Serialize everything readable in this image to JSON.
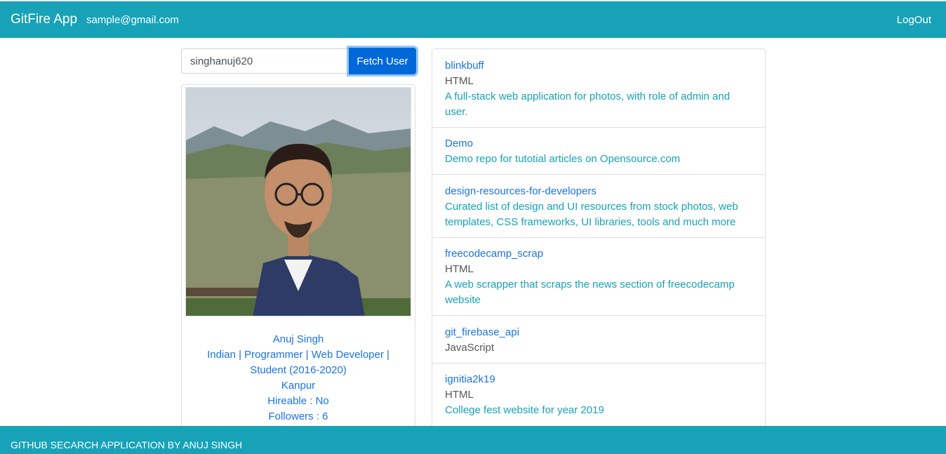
{
  "navbar": {
    "brand": "GitFire App",
    "email": "sample@gmail.com",
    "logout": "LogOut"
  },
  "search": {
    "value": "singhanuj620",
    "button_label": "Fetch User"
  },
  "profile": {
    "name": "Anuj Singh",
    "bio": "Indian | Programmer | Web Developer | Student (2016-2020)",
    "location": "Kanpur",
    "hireable": "Hireable : No",
    "followers": "Followers : 6"
  },
  "repos": [
    {
      "name": "blinkbuff",
      "language": "HTML",
      "description": "A full-stack web application for photos, with role of admin and user."
    },
    {
      "name": "Demo",
      "language": "",
      "description": "Demo repo for tutotial articles on Opensource.com"
    },
    {
      "name": "design-resources-for-developers",
      "language": "",
      "description": "Curated list of design and UI resources from stock photos, web templates, CSS frameworks, UI libraries, tools and much more"
    },
    {
      "name": "freecodecamp_scrap",
      "language": "HTML",
      "description": "A web scrapper that scraps the news section of freecodecamp website"
    },
    {
      "name": "git_firebase_api",
      "language": "JavaScript",
      "description": ""
    },
    {
      "name": "ignitia2k19",
      "language": "HTML",
      "description": "College fest website for year 2019"
    }
  ],
  "footer": {
    "text": "GITHUB SECARCH APPLICATION BY ANUJ SINGH"
  },
  "colors": {
    "primary": "#17a2b8",
    "button": "#0069d9",
    "link": "#1a73e8"
  }
}
